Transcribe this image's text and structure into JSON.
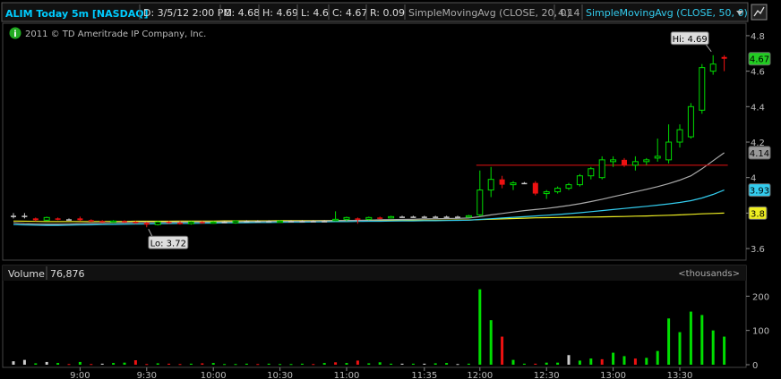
{
  "header": {
    "symbol": "ALIM Today 5m [NASDAQ]",
    "date": "D: 3/5/12 2:00 PM",
    "open": "O: 4.68",
    "high": "H: 4.69",
    "low": "L: 4.6",
    "close": "C: 4.67",
    "range": "R: 0.09",
    "sma20": "SimpleMovingAvg (CLOSE, 20, 0)",
    "sma20_value": "4.14",
    "sma50": "SimpleMovingAvg (CLOSE, 50, 0)",
    "copyright": "2011 © TD Ameritrade IP Company, Inc.",
    "info_icon": "info-icon",
    "dropdown_icon": "chevron-down-icon",
    "menu_icon": "chart-menu-icon"
  },
  "labels": {
    "hi": "Hi: 4.69",
    "lo": "Lo: 3.72",
    "price_last": "4.67",
    "sma20_last": "4.14",
    "sma50_last": "3.93",
    "sma_slow_last": "3.8",
    "volume_title": "Volume",
    "volume_value": "76,876",
    "volume_unit": "<thousands>"
  },
  "colors": {
    "up": "#00dd00",
    "down": "#ee1111",
    "doji": "#cccccc",
    "sma20": "#aaaaaa",
    "sma50": "#33ccee",
    "sma_slow": "#eeee22",
    "resistance": "#cc1111",
    "header_text": "#00ccff"
  },
  "chart_data": {
    "type": "candlestick",
    "title": "ALIM Today 5m [NASDAQ]",
    "price_axis": {
      "ylim": [
        3.55,
        4.85
      ],
      "ticks": [
        "4.8",
        "4.6",
        "4.4",
        "4.2",
        "4",
        "3.8",
        "3.6"
      ]
    },
    "volume_axis": {
      "ylim": [
        0,
        240
      ],
      "ticks": [
        "200",
        "100",
        "0"
      ],
      "unit": "thousands"
    },
    "time_ticks": [
      {
        "label": "9:00",
        "bar": 6
      },
      {
        "label": "9:30",
        "bar": 12
      },
      {
        "label": "10:00",
        "bar": 18
      },
      {
        "label": "10:30",
        "bar": 24
      },
      {
        "label": "11:00",
        "bar": 30
      },
      {
        "label": "11:35",
        "bar": 37
      },
      {
        "label": "12:00",
        "bar": 42
      },
      {
        "label": "12:30",
        "bar": 48
      },
      {
        "label": "13:00",
        "bar": 54
      },
      {
        "label": "13:30",
        "bar": 60
      }
    ],
    "candles": [
      {
        "o": 3.785,
        "h": 3.8,
        "l": 3.77,
        "c": 3.785
      },
      {
        "o": 3.785,
        "h": 3.8,
        "l": 3.77,
        "c": 3.785
      },
      {
        "o": 3.77,
        "h": 3.775,
        "l": 3.755,
        "c": 3.76
      },
      {
        "o": 3.76,
        "h": 3.78,
        "l": 3.755,
        "c": 3.775
      },
      {
        "o": 3.77,
        "h": 3.775,
        "l": 3.76,
        "c": 3.765
      },
      {
        "o": 3.765,
        "h": 3.77,
        "l": 3.76,
        "c": 3.765
      },
      {
        "o": 3.77,
        "h": 3.78,
        "l": 3.755,
        "c": 3.76
      },
      {
        "o": 3.76,
        "h": 3.765,
        "l": 3.75,
        "c": 3.755
      },
      {
        "o": 3.755,
        "h": 3.76,
        "l": 3.745,
        "c": 3.75
      },
      {
        "o": 3.75,
        "h": 3.76,
        "l": 3.745,
        "c": 3.755
      },
      {
        "o": 3.755,
        "h": 3.76,
        "l": 3.745,
        "c": 3.75
      },
      {
        "o": 3.75,
        "h": 3.755,
        "l": 3.74,
        "c": 3.745
      },
      {
        "o": 3.745,
        "h": 3.75,
        "l": 3.72,
        "c": 3.735
      },
      {
        "o": 3.735,
        "h": 3.755,
        "l": 3.73,
        "c": 3.75
      },
      {
        "o": 3.75,
        "h": 3.755,
        "l": 3.74,
        "c": 3.745
      },
      {
        "o": 3.745,
        "h": 3.755,
        "l": 3.735,
        "c": 3.74
      },
      {
        "o": 3.74,
        "h": 3.755,
        "l": 3.735,
        "c": 3.75
      },
      {
        "o": 3.75,
        "h": 3.755,
        "l": 3.74,
        "c": 3.745
      },
      {
        "o": 3.745,
        "h": 3.755,
        "l": 3.74,
        "c": 3.75
      },
      {
        "o": 3.75,
        "h": 3.755,
        "l": 3.745,
        "c": 3.75
      },
      {
        "o": 3.745,
        "h": 3.76,
        "l": 3.74,
        "c": 3.755
      },
      {
        "o": 3.755,
        "h": 3.76,
        "l": 3.75,
        "c": 3.755
      },
      {
        "o": 3.755,
        "h": 3.76,
        "l": 3.75,
        "c": 3.755
      },
      {
        "o": 3.755,
        "h": 3.76,
        "l": 3.75,
        "c": 3.755
      },
      {
        "o": 3.75,
        "h": 3.76,
        "l": 3.745,
        "c": 3.755
      },
      {
        "o": 3.755,
        "h": 3.76,
        "l": 3.75,
        "c": 3.755
      },
      {
        "o": 3.755,
        "h": 3.76,
        "l": 3.75,
        "c": 3.755
      },
      {
        "o": 3.755,
        "h": 3.76,
        "l": 3.75,
        "c": 3.755
      },
      {
        "o": 3.755,
        "h": 3.76,
        "l": 3.75,
        "c": 3.755
      },
      {
        "o": 3.76,
        "h": 3.81,
        "l": 3.755,
        "c": 3.765
      },
      {
        "o": 3.765,
        "h": 3.78,
        "l": 3.755,
        "c": 3.775
      },
      {
        "o": 3.77,
        "h": 3.775,
        "l": 3.74,
        "c": 3.765
      },
      {
        "o": 3.765,
        "h": 3.78,
        "l": 3.76,
        "c": 3.775
      },
      {
        "o": 3.775,
        "h": 3.78,
        "l": 3.765,
        "c": 3.77
      },
      {
        "o": 3.775,
        "h": 3.785,
        "l": 3.77,
        "c": 3.78
      },
      {
        "o": 3.78,
        "h": 3.785,
        "l": 3.775,
        "c": 3.78
      },
      {
        "o": 3.78,
        "h": 3.785,
        "l": 3.775,
        "c": 3.78
      },
      {
        "o": 3.78,
        "h": 3.785,
        "l": 3.775,
        "c": 3.78
      },
      {
        "o": 3.78,
        "h": 3.785,
        "l": 3.775,
        "c": 3.78
      },
      {
        "o": 3.78,
        "h": 3.785,
        "l": 3.775,
        "c": 3.78
      },
      {
        "o": 3.78,
        "h": 3.785,
        "l": 3.775,
        "c": 3.78
      },
      {
        "o": 3.78,
        "h": 3.79,
        "l": 3.775,
        "c": 3.785
      },
      {
        "o": 3.79,
        "h": 4.04,
        "l": 3.78,
        "c": 3.93
      },
      {
        "o": 3.93,
        "h": 4.06,
        "l": 3.89,
        "c": 3.99
      },
      {
        "o": 3.99,
        "h": 4.01,
        "l": 3.94,
        "c": 3.96
      },
      {
        "o": 3.96,
        "h": 3.98,
        "l": 3.93,
        "c": 3.97
      },
      {
        "o": 3.97,
        "h": 3.975,
        "l": 3.965,
        "c": 3.97
      },
      {
        "o": 3.97,
        "h": 3.98,
        "l": 3.9,
        "c": 3.91
      },
      {
        "o": 3.91,
        "h": 3.93,
        "l": 3.88,
        "c": 3.92
      },
      {
        "o": 3.92,
        "h": 3.95,
        "l": 3.91,
        "c": 3.94
      },
      {
        "o": 3.94,
        "h": 3.97,
        "l": 3.93,
        "c": 3.96
      },
      {
        "o": 3.96,
        "h": 4.02,
        "l": 3.95,
        "c": 4.01
      },
      {
        "o": 4.01,
        "h": 4.06,
        "l": 3.99,
        "c": 4.05
      },
      {
        "o": 4.0,
        "h": 4.12,
        "l": 3.99,
        "c": 4.1
      },
      {
        "o": 4.09,
        "h": 4.12,
        "l": 4.06,
        "c": 4.1
      },
      {
        "o": 4.1,
        "h": 4.11,
        "l": 4.06,
        "c": 4.07
      },
      {
        "o": 4.07,
        "h": 4.12,
        "l": 4.04,
        "c": 4.09
      },
      {
        "o": 4.09,
        "h": 4.11,
        "l": 4.07,
        "c": 4.1
      },
      {
        "o": 4.11,
        "h": 4.22,
        "l": 4.09,
        "c": 4.12
      },
      {
        "o": 4.1,
        "h": 4.3,
        "l": 4.08,
        "c": 4.2
      },
      {
        "o": 4.2,
        "h": 4.3,
        "l": 4.17,
        "c": 4.27
      },
      {
        "o": 4.23,
        "h": 4.42,
        "l": 4.22,
        "c": 4.4
      },
      {
        "o": 4.38,
        "h": 4.64,
        "l": 4.36,
        "c": 4.62
      },
      {
        "o": 4.6,
        "h": 4.69,
        "l": 4.58,
        "c": 4.64
      },
      {
        "o": 4.68,
        "h": 4.69,
        "l": 4.6,
        "c": 4.67
      }
    ],
    "volume": [
      10,
      14,
      4,
      8,
      5,
      2,
      8,
      2,
      3,
      5,
      6,
      13,
      2,
      4,
      3,
      2,
      3,
      4,
      5,
      2,
      2,
      3,
      2,
      3,
      2,
      2,
      3,
      2,
      5,
      7,
      5,
      12,
      4,
      7,
      3,
      3,
      3,
      3,
      4,
      5,
      2,
      3,
      220,
      130,
      82,
      14,
      3,
      3,
      6,
      6,
      28,
      12,
      18,
      16,
      35,
      25,
      18,
      20,
      40,
      135,
      95,
      155,
      145,
      100,
      82
    ],
    "volume_colors": [
      "doji",
      "doji",
      "up",
      "doji",
      "up",
      "down",
      "up",
      "down",
      "doji",
      "up",
      "up",
      "down",
      "down",
      "up",
      "down",
      "down",
      "up",
      "down",
      "up",
      "up",
      "up",
      "up",
      "down",
      "up",
      "up",
      "up",
      "up",
      "down",
      "up",
      "down",
      "up",
      "down",
      "up",
      "up",
      "up",
      "doji",
      "up",
      "doji",
      "up",
      "up",
      "doji",
      "up",
      "up",
      "up",
      "down",
      "up",
      "up",
      "down",
      "up",
      "up",
      "doji",
      "up",
      "up",
      "down",
      "up",
      "up",
      "down",
      "up",
      "up",
      "up",
      "up",
      "up",
      "up",
      "up",
      "up"
    ],
    "sma20": {
      "name": "SimpleMovingAvg (CLOSE, 20, 0)",
      "values": [
        3.745,
        3.74,
        3.738,
        3.737,
        3.737,
        3.738,
        3.74,
        3.742,
        3.743,
        3.745,
        3.746,
        3.747,
        3.748,
        3.748,
        3.749,
        3.749,
        3.75,
        3.75,
        3.75,
        3.751,
        3.751,
        3.752,
        3.752,
        3.753,
        3.753,
        3.754,
        3.754,
        3.755,
        3.756,
        3.757,
        3.758,
        3.759,
        3.76,
        3.762,
        3.763,
        3.764,
        3.765,
        3.767,
        3.768,
        3.769,
        3.77,
        3.772,
        3.78,
        3.79,
        3.798,
        3.806,
        3.814,
        3.82,
        3.826,
        3.834,
        3.843,
        3.853,
        3.865,
        3.878,
        3.892,
        3.906,
        3.92,
        3.934,
        3.949,
        3.966,
        3.986,
        4.01,
        4.05,
        4.095,
        4.14
      ]
    },
    "sma50": {
      "name": "SimpleMovingAvg (CLOSE, 50, 0)",
      "values": [
        3.735,
        3.733,
        3.732,
        3.731,
        3.731,
        3.732,
        3.733,
        3.734,
        3.735,
        3.736,
        3.737,
        3.738,
        3.739,
        3.74,
        3.741,
        3.742,
        3.742,
        3.743,
        3.744,
        3.745,
        3.745,
        3.746,
        3.747,
        3.747,
        3.748,
        3.749,
        3.749,
        3.75,
        3.751,
        3.752,
        3.752,
        3.753,
        3.754,
        3.754,
        3.755,
        3.756,
        3.756,
        3.757,
        3.757,
        3.758,
        3.759,
        3.76,
        3.764,
        3.768,
        3.772,
        3.776,
        3.78,
        3.784,
        3.788,
        3.792,
        3.797,
        3.802,
        3.808,
        3.814,
        3.82,
        3.826,
        3.832,
        3.838,
        3.845,
        3.852,
        3.86,
        3.87,
        3.885,
        3.905,
        3.93
      ]
    },
    "sma_slow": {
      "values": [
        3.755,
        3.754,
        3.753,
        3.752,
        3.752,
        3.752,
        3.752,
        3.752,
        3.753,
        3.753,
        3.753,
        3.754,
        3.754,
        3.754,
        3.754,
        3.755,
        3.755,
        3.755,
        3.755,
        3.756,
        3.756,
        3.756,
        3.756,
        3.756,
        3.757,
        3.757,
        3.757,
        3.757,
        3.758,
        3.758,
        3.758,
        3.758,
        3.759,
        3.759,
        3.759,
        3.759,
        3.76,
        3.76,
        3.76,
        3.76,
        3.761,
        3.761,
        3.763,
        3.765,
        3.767,
        3.769,
        3.771,
        3.773,
        3.774,
        3.775,
        3.776,
        3.777,
        3.778,
        3.779,
        3.78,
        3.781,
        3.783,
        3.784,
        3.786,
        3.788,
        3.79,
        3.793,
        3.796,
        3.798,
        3.8
      ]
    },
    "resistance": {
      "value": 4.07,
      "from_bar": 42,
      "to_bar": 64
    },
    "hi": {
      "value": 4.69,
      "bar": 63
    },
    "lo": {
      "value": 3.72,
      "bar": 12
    }
  }
}
